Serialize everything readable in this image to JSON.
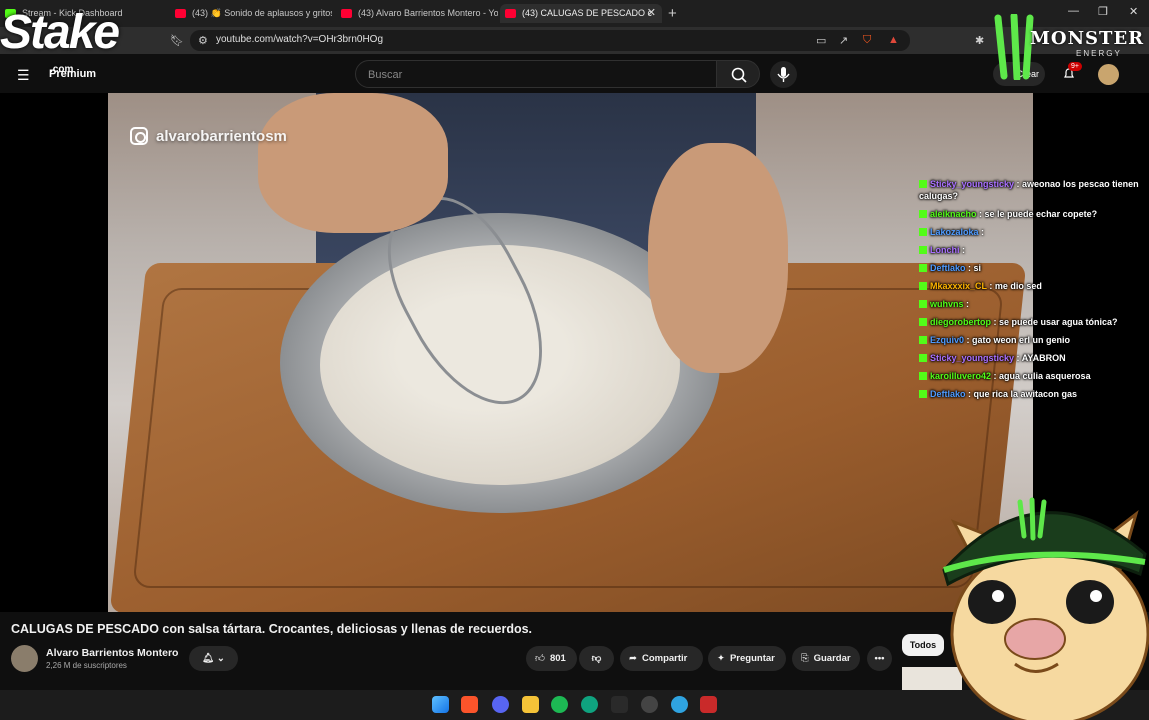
{
  "browser": {
    "tabs": [
      {
        "title": "Stream - Kick Dashboard",
        "type": "kick"
      },
      {
        "title": "(43) 👏 Sonido de aplausos y gritos",
        "type": "youtube"
      },
      {
        "title": "(43) Alvaro Barrientos Montero - You",
        "type": "youtube"
      },
      {
        "title": "(43) CALUGAS DE PESCADO c",
        "type": "youtube",
        "active": true
      }
    ],
    "url": "youtube.com/watch?v=OHr3brn0HOg"
  },
  "youtube": {
    "logo_suffix": "Premium",
    "search_placeholder": "Buscar",
    "create_label": "Crear",
    "notifications_badge": "9+",
    "video": {
      "watermark": "alvarobarrientosm",
      "title": "CALUGAS DE PESCADO con salsa tártara. Crocantes, deliciosas y llenas de recuerdos.",
      "channel": "Alvaro Barrientos Montero",
      "subscribers": "2,26 M de suscriptores",
      "likes": "801",
      "share_label": "Compartir",
      "ask_label": "Preguntar",
      "save_label": "Guardar"
    },
    "sidebar_chip": "Todos"
  },
  "overlays": {
    "stake_text": "Stake",
    "stake_com": ".com",
    "monster_text": "MONSTER",
    "monster_sub": "ENERGY"
  },
  "chat": [
    {
      "user": "Sticky_youngsticky",
      "color": "#a970ff",
      "text": "aweonao los pescao tienen calugas?"
    },
    {
      "user": "aleiknacho",
      "color": "#53fc18",
      "text": "se le puede echar copete?"
    },
    {
      "user": "Lakozaloka",
      "color": "#4e9bff",
      "text": ""
    },
    {
      "user": "Lonchi",
      "color": "#a970ff",
      "text": ""
    },
    {
      "user": "Deftlako",
      "color": "#4e9bff",
      "text": "si"
    },
    {
      "user": "Mkaxxxix_CL",
      "color": "#ffb400",
      "text": "me dio sed"
    },
    {
      "user": "wuhvns",
      "color": "#53fc18",
      "text": ""
    },
    {
      "user": "diegorobertop",
      "color": "#53fc18",
      "text": "se puede usar agua tónica?"
    },
    {
      "user": "Ezquiv0",
      "color": "#4e9bff",
      "text": "gato weon erl un genio"
    },
    {
      "user": "Sticky_youngsticky",
      "color": "#a970ff",
      "text": "AYABRON"
    },
    {
      "user": "karoilluvero42",
      "color": "#53fc18",
      "text": "agua culia asquerosa"
    },
    {
      "user": "Deftlako",
      "color": "#4e9bff",
      "text": "que rica la awitacon gas"
    }
  ]
}
